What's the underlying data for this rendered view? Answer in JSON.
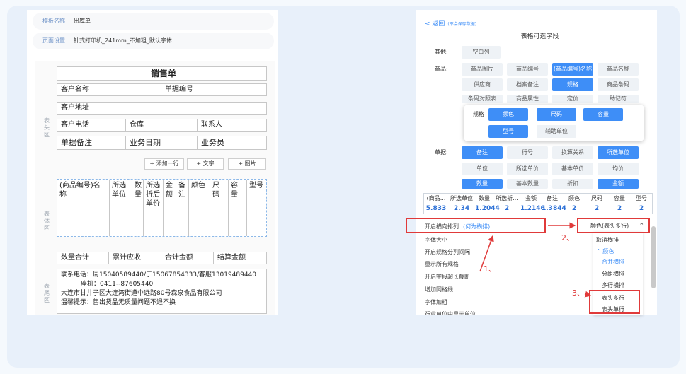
{
  "left": {
    "template_label": "模板名称",
    "template_value": "出库单",
    "page_label": "页面设置",
    "page_value": "针式打印机_241mm_不加粗_默认字体",
    "sections": {
      "head": "表头区",
      "body": "表体区",
      "foot": "表尾区"
    },
    "title": "销售单",
    "fields": {
      "customer": "客户名称",
      "docno": "单据编号",
      "address": "客户地址",
      "phone": "客户电话",
      "warehouse": "仓库",
      "contact": "联系人",
      "remark": "单据备注",
      "bizdate": "业务日期",
      "salesman": "业务员"
    },
    "buttons": {
      "add_row": "+ 添加一行",
      "text": "+ 文字",
      "image": "+ 图片"
    },
    "columns": [
      "(商品编号)名称",
      "所选单位",
      "数量",
      "所选折后单价",
      "金额",
      "备注",
      "颜色",
      "尺码",
      "容量",
      "型号"
    ],
    "totals": [
      "数量合计",
      "累计应收",
      "合计金额",
      "结算金额"
    ],
    "footer": [
      "联系电话：周15040589440/于15067854333/客服13019489440",
      "座机：0411--87605440",
      "大连市甘井子区大连湾街道中远路80号森泉食品有限公司",
      "温馨提示：售出货品无质量问题不退不换"
    ]
  },
  "right": {
    "back": "< 返回",
    "back_hint": "(不会保存数据)",
    "title": "表格可选字段",
    "other_label": "其他:",
    "other": [
      "空白列"
    ],
    "goods_label": "商品:",
    "goods": [
      "商品图片",
      "商品编号",
      "(商品编号)名称",
      "商品名称",
      "供应商",
      "档案备注",
      "规格",
      "商品条码",
      "条码对照表",
      "商品属性",
      "定价",
      "助记符"
    ],
    "spec_label": "规格",
    "spec": [
      "颜色",
      "尺码",
      "容量",
      "型号",
      "辅助单位"
    ],
    "doc_label": "单据:",
    "doc": [
      "备注",
      "行号",
      "换算关系",
      "所选单位",
      "单位",
      "所选单价",
      "基本单价",
      "均价",
      "数量",
      "基本数量",
      "折扣",
      "金额"
    ],
    "table_head": [
      "(商品...",
      "所选单位",
      "数量",
      "所选折...",
      "金额",
      "备注",
      "颜色",
      "尺码",
      "容量",
      "型号"
    ],
    "table_vals": [
      "5.833",
      "2.34",
      "1.2044",
      "2",
      "1.2146",
      "1.3844",
      "2",
      "2",
      "2",
      "2"
    ],
    "options": [
      "开启横向排列",
      "字体大小",
      "开启规格分列间隔",
      "显示所有规格",
      "开启字段超长截断",
      "增加网格线",
      "字体加粗",
      "行业单位中显示单位"
    ],
    "option_hint": "(何为横排)",
    "dropdown_value": "颜色(表头多行)",
    "dropdown": [
      "取消横排",
      "颜色",
      "合并横排",
      "分组横排",
      "多行横排",
      "表头多行",
      "表头单行"
    ],
    "annotations": [
      "1、",
      "2、",
      "3、"
    ]
  }
}
